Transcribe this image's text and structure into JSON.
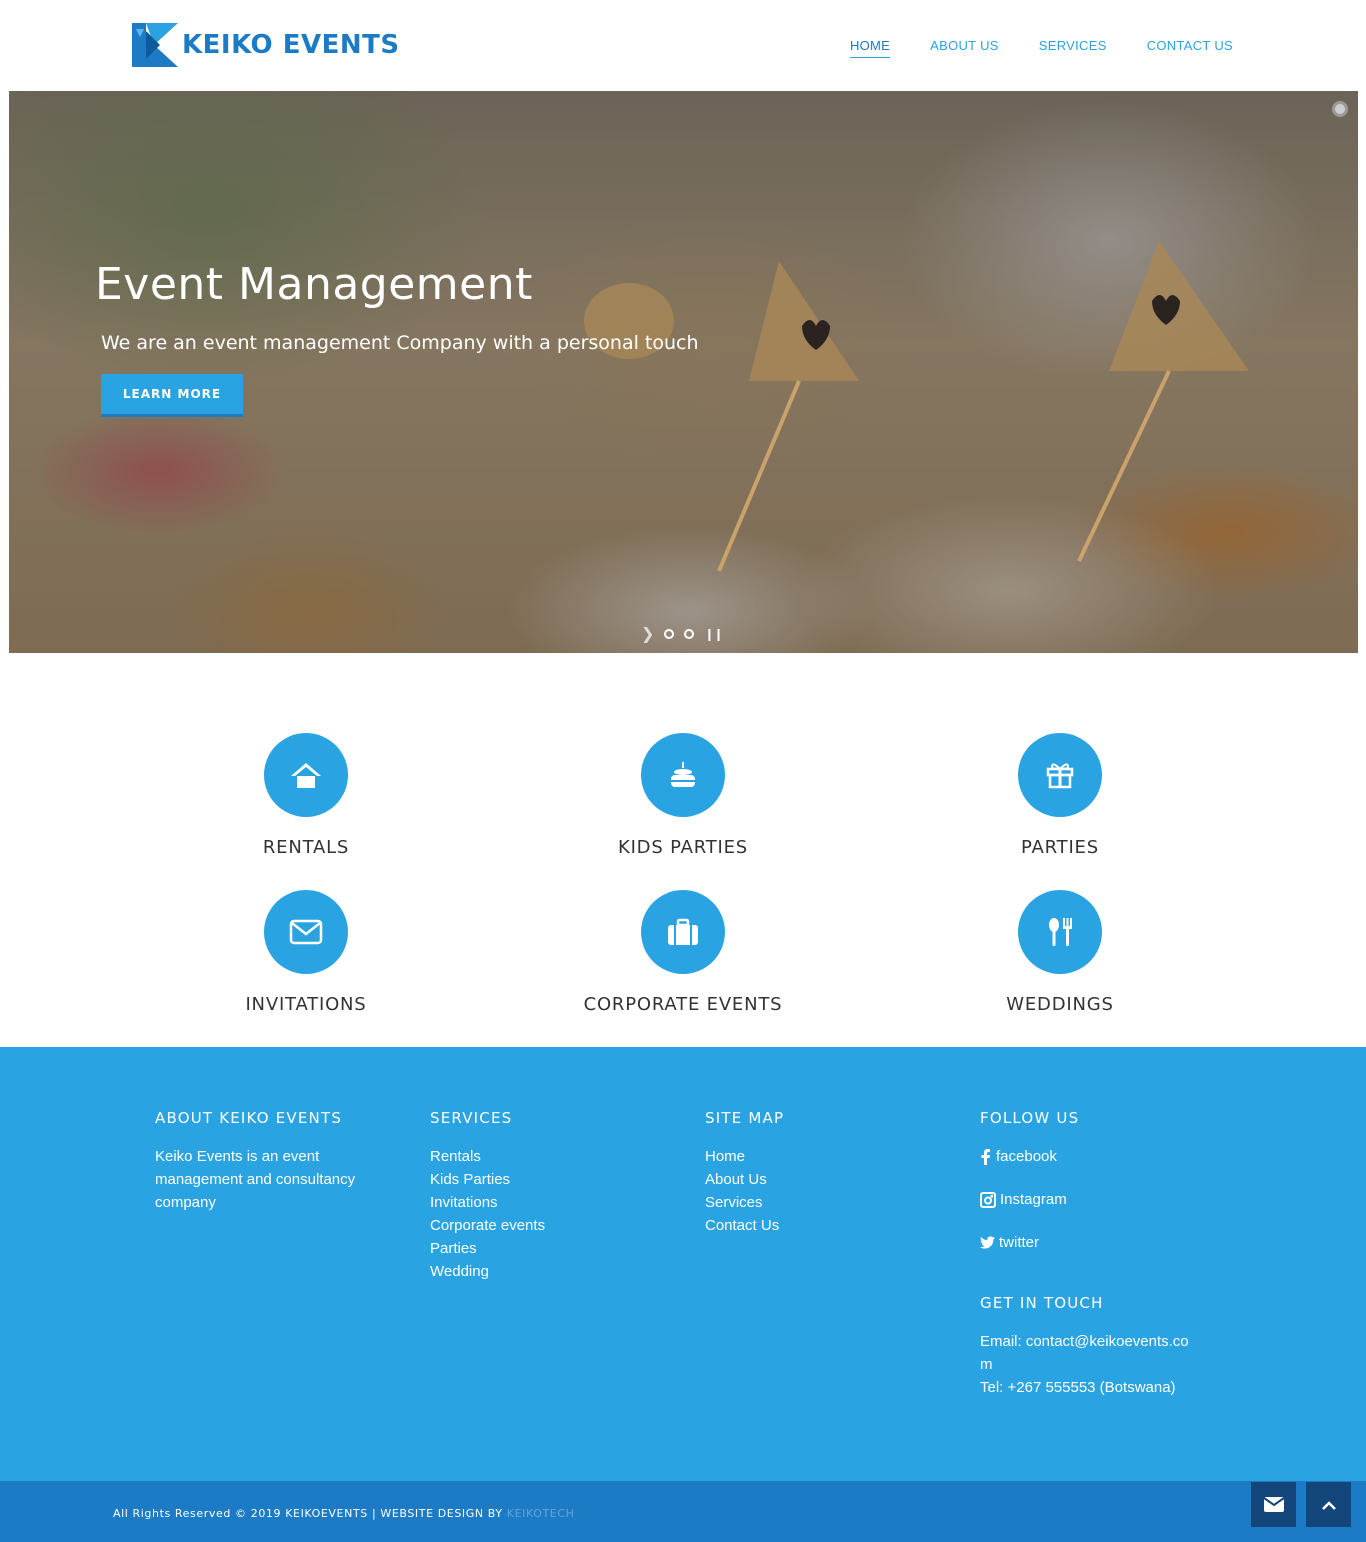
{
  "header": {
    "logo_text": "KEIKO EVENTS",
    "nav": [
      "HOME",
      "ABOUT US",
      "SERVICES",
      "CONTACT US"
    ]
  },
  "hero": {
    "title": "Event Management",
    "subtitle": "We are an event management Company with a personal touch",
    "button": "LEARN MORE"
  },
  "services": [
    {
      "label": "RENTALS",
      "icon": "house-icon"
    },
    {
      "label": "KIDS PARTIES",
      "icon": "cake-icon"
    },
    {
      "label": "PARTIES",
      "icon": "gift-icon"
    },
    {
      "label": "INVITATIONS",
      "icon": "envelope-icon"
    },
    {
      "label": "CORPORATE EVENTS",
      "icon": "briefcase-icon"
    },
    {
      "label": "WEDDINGS",
      "icon": "cutlery-icon"
    }
  ],
  "footer": {
    "about": {
      "heading": "ABOUT KEIKO EVENTS",
      "text": "Keiko Events is an event management and consultancy company"
    },
    "services": {
      "heading": "SERVICES",
      "items": [
        "Rentals",
        "Kids Parties",
        "Invitations",
        "Corporate events",
        "Parties",
        "Wedding"
      ]
    },
    "sitemap": {
      "heading": "SITE MAP",
      "items": [
        "Home",
        "About Us",
        "Services",
        "Contact Us"
      ]
    },
    "follow": {
      "heading": "FOLLOW US",
      "items": [
        {
          "label": "facebook",
          "icon": "facebook-icon"
        },
        {
          "label": "Instagram",
          "icon": "instagram-icon"
        },
        {
          "label": "twitter",
          "icon": "twitter-icon"
        }
      ]
    },
    "contact": {
      "heading": "GET IN TOUCH",
      "email_line1": "Email: contact@keikoevents.co",
      "email_line2": "m",
      "tel": "Tel: +267 555553 (Botswana)"
    },
    "copyright": "All Rights Reserved © 2019 KEIKOEVENTS | WEBSITE DESIGN BY ",
    "designer": "KEIKOTECH"
  },
  "colors": {
    "accent": "#2aa3e3",
    "dark_accent": "#1c7bc4",
    "button_dark": "#13467a"
  }
}
